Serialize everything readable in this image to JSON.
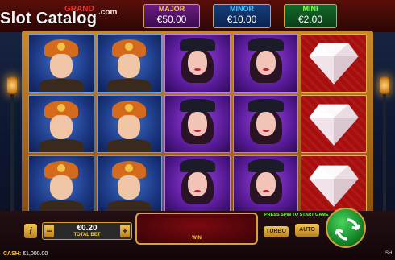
{
  "logo": {
    "text": "Slot Catalog",
    "suffix": ".com"
  },
  "jackpots": {
    "grand": {
      "label": "GRAND"
    },
    "major": {
      "label": "MAJOR",
      "value": "€50.00"
    },
    "minor": {
      "label": "MINOR",
      "value": "€10.00"
    },
    "mini": {
      "label": "MINI",
      "value": "€2.00"
    }
  },
  "reels": [
    [
      "detective",
      "detective",
      "detective"
    ],
    [
      "detective",
      "detective",
      "detective"
    ],
    [
      "lady",
      "lady",
      "lady"
    ],
    [
      "lady",
      "lady",
      "lady"
    ],
    [
      "diamond",
      "diamond",
      "diamond"
    ]
  ],
  "controls": {
    "info_label": "i",
    "bet_minus": "−",
    "bet_plus": "+",
    "bet_value": "€0.20",
    "bet_label": "TOTAL BET",
    "win_label": "WIN",
    "press_spin": "PRESS SPIN TO START GAME",
    "turbo_label": "TURBO",
    "auto_label": "AUTO"
  },
  "footer": {
    "cash_label": "CASH:",
    "cash_value": "€1,000.00",
    "right_text": "SH"
  },
  "colors": {
    "accent_gold": "#d6a13a",
    "spin_green": "#1fa83a",
    "frame_red": "#a80e0e"
  }
}
